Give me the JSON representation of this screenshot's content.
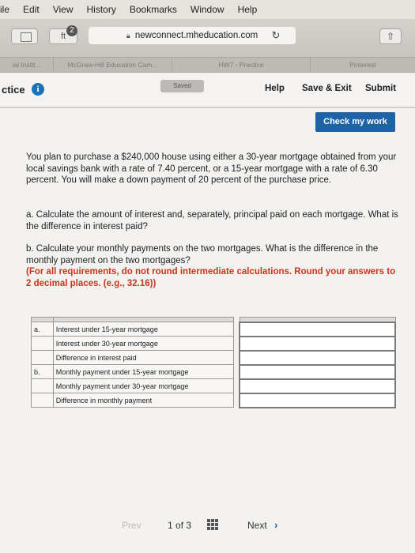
{
  "menubar": {
    "items": [
      "ile",
      "Edit",
      "View",
      "History",
      "Bookmarks",
      "Window",
      "Help"
    ]
  },
  "toolbar": {
    "url": "newconnect.mheducation.com",
    "extension_badge": "2",
    "extension_glyph": "ft",
    "reload_glyph": "↻",
    "share_glyph": "⇧"
  },
  "tabs": [
    {
      "label": "ial Instit..."
    },
    {
      "label": "McGraw-Hill Education Cam..."
    },
    {
      "label": "HW7 - Practice"
    },
    {
      "label": "Pinterest"
    }
  ],
  "header": {
    "practice_label": "ctice",
    "info_glyph": "i",
    "saved_label": "Saved",
    "help_label": "Help",
    "save_exit_label": "Save & Exit",
    "submit_label": "Submit"
  },
  "content": {
    "check_label": "Check my work",
    "problem": "You plan to purchase a $240,000 house using either a 30-year mortgage obtained from your local savings bank with a rate of 7.40 percent, or a 15-year mortgage with a rate of 6.30 percent. You will make a down payment of 20 percent of the purchase price.",
    "part_a": "a. Calculate the amount of interest and, separately, principal paid on each mortgage. What is the difference in interest paid?",
    "part_b": "b. Calculate your monthly payments on the two mortgages. What is the difference in the monthly payment on the two mortgages?",
    "instruction": "(For all requirements, do not round intermediate calculations. Round your answers to 2 decimal places. (e.g., 32.16))",
    "rows": [
      {
        "label": "a.",
        "desc": "Interest under 15-year mortgage"
      },
      {
        "label": "",
        "desc": "Interest under 30-year mortgage"
      },
      {
        "label": "",
        "desc": "Difference in interest paid"
      },
      {
        "label": "b.",
        "desc": "Monthly payment under 15-year mortgage"
      },
      {
        "label": "",
        "desc": "Monthly payment under 30-year mortgage"
      },
      {
        "label": "",
        "desc": "Difference in monthly payment"
      }
    ]
  },
  "pager": {
    "prev_label": "Prev",
    "current": "1",
    "of_label": "of",
    "total": "3",
    "next_label": "Next",
    "next_glyph": "›"
  },
  "colors": {
    "accent_blue": "#1d63a7",
    "instruction_red": "#c8361b"
  }
}
